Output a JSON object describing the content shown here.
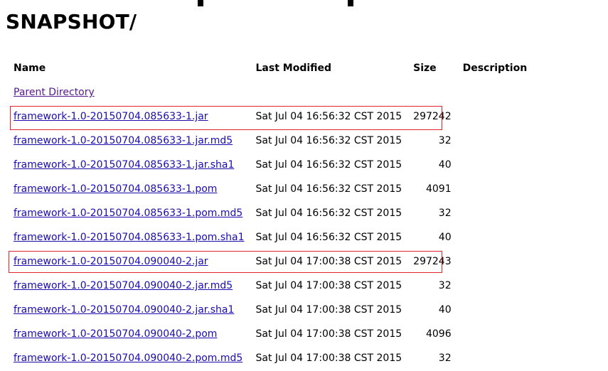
{
  "page": {
    "title": "SNAPSHOT/"
  },
  "table": {
    "headers": {
      "name": "Name",
      "last_modified": "Last Modified",
      "size": "Size",
      "description": "Description"
    },
    "parent_link": "Parent Directory",
    "rows": [
      {
        "name": "framework-1.0-20150704.085633-1.jar",
        "modified": "Sat Jul 04 16:56:32 CST 2015",
        "size": "297242",
        "description": ""
      },
      {
        "name": "framework-1.0-20150704.085633-1.jar.md5",
        "modified": "Sat Jul 04 16:56:32 CST 2015",
        "size": "32",
        "description": ""
      },
      {
        "name": "framework-1.0-20150704.085633-1.jar.sha1",
        "modified": "Sat Jul 04 16:56:32 CST 2015",
        "size": "40",
        "description": ""
      },
      {
        "name": "framework-1.0-20150704.085633-1.pom",
        "modified": "Sat Jul 04 16:56:32 CST 2015",
        "size": "4091",
        "description": ""
      },
      {
        "name": "framework-1.0-20150704.085633-1.pom.md5",
        "modified": "Sat Jul 04 16:56:32 CST 2015",
        "size": "32",
        "description": ""
      },
      {
        "name": "framework-1.0-20150704.085633-1.pom.sha1",
        "modified": "Sat Jul 04 16:56:32 CST 2015",
        "size": "40",
        "description": ""
      },
      {
        "name": "framework-1.0-20150704.090040-2.jar",
        "modified": "Sat Jul 04 17:00:38 CST 2015",
        "size": "297243",
        "description": ""
      },
      {
        "name": "framework-1.0-20150704.090040-2.jar.md5",
        "modified": "Sat Jul 04 17:00:38 CST 2015",
        "size": "32",
        "description": ""
      },
      {
        "name": "framework-1.0-20150704.090040-2.jar.sha1",
        "modified": "Sat Jul 04 17:00:38 CST 2015",
        "size": "40",
        "description": ""
      },
      {
        "name": "framework-1.0-20150704.090040-2.pom",
        "modified": "Sat Jul 04 17:00:38 CST 2015",
        "size": "4096",
        "description": ""
      },
      {
        "name": "framework-1.0-20150704.090040-2.pom.md5",
        "modified": "Sat Jul 04 17:00:38 CST 2015",
        "size": "32",
        "description": ""
      }
    ]
  },
  "annotations": {
    "highlight_color": "#e0242a"
  }
}
